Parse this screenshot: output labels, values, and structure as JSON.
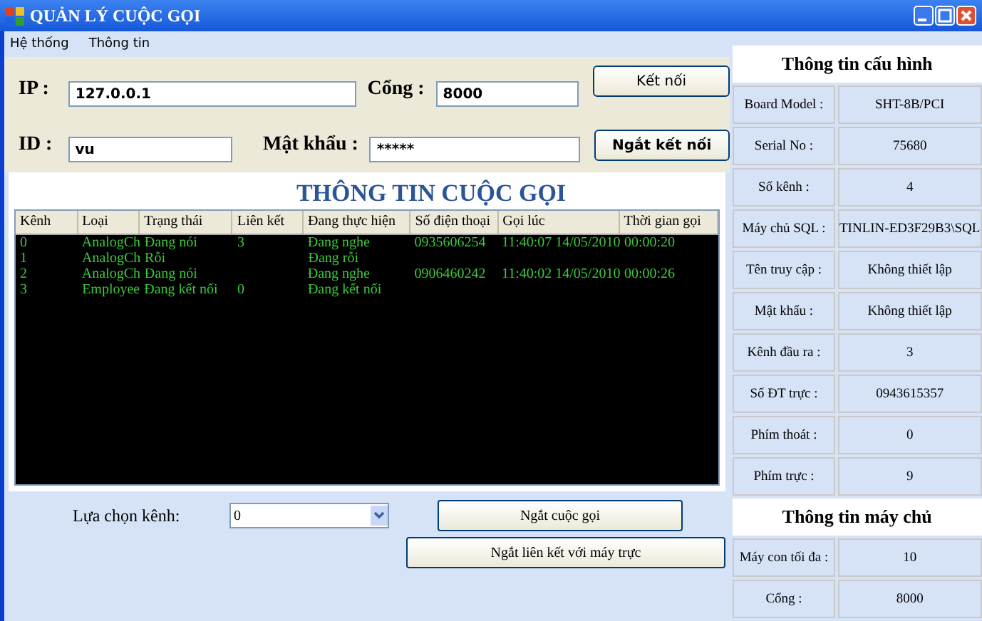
{
  "window": {
    "title": "QUẢN LÝ CUỘC GỌI"
  },
  "menu": [
    "Hệ thống",
    "Thông tin"
  ],
  "connection": {
    "ip_label": "IP :",
    "ip": "127.0.0.1",
    "port_label": "Cổng :",
    "port": "8000",
    "id_label": "ID :",
    "id": "vu",
    "password_label": "Mật khẩu :",
    "password": "*****",
    "connect_button": "Kết nối",
    "disconnect_button": "Ngắt kết nối"
  },
  "calls": {
    "title": "THÔNG TIN CUỘC GỌI",
    "columns": [
      "Kênh",
      "Loại",
      "Trạng thái",
      "Liên kết",
      "Đang thực hiện",
      "Số điện thoại",
      "Gọi lúc",
      "Thời gian gọi"
    ],
    "rows": [
      [
        "0",
        "AnalogCh",
        "Đang nói",
        "3",
        "Đang nghe",
        "0935606254",
        "11:40:07 14/05/2010",
        "00:00:20"
      ],
      [
        "1",
        "AnalogCh",
        "Rỗi",
        "",
        "Đang rỗi",
        "",
        "",
        ""
      ],
      [
        "2",
        "AnalogCh",
        "Đang nói",
        "",
        "Đang nghe",
        "0906460242",
        "11:40:02 14/05/2010",
        "00:00:26"
      ],
      [
        "3",
        "Employee",
        "Đang kết nối",
        "0",
        "Đang kết nối",
        "",
        "",
        ""
      ]
    ]
  },
  "channel_select": {
    "label": "Lựa chọn kênh:",
    "value": "0"
  },
  "hangup_button": "Ngắt cuộc gọi",
  "unlink_button": "Ngắt liên kết với máy trực",
  "config": {
    "title": "Thông tin cấu hình",
    "rows": [
      {
        "label": "Board Model :",
        "value": "SHT-8B/PCI"
      },
      {
        "label": "Serial No :",
        "value": "75680"
      },
      {
        "label": "Số kênh :",
        "value": "4"
      },
      {
        "label": "Máy chủ SQL :",
        "value": "TINLIN-ED3F29B3\\SQL"
      },
      {
        "label": "Tên truy cập :",
        "value": "Không thiết lập"
      },
      {
        "label": "Mật khẩu :",
        "value": "Không thiết lập"
      },
      {
        "label": "Kênh đầu ra :",
        "value": "3"
      },
      {
        "label": "Số ĐT trực :",
        "value": "0943615357"
      },
      {
        "label": "Phím thoát :",
        "value": "0"
      },
      {
        "label": "Phím trực :",
        "value": "9"
      }
    ]
  },
  "server": {
    "title": "Thông tin máy chủ",
    "rows": [
      {
        "label": "Máy con tối đa :",
        "value": "10"
      },
      {
        "label": "Cổng :",
        "value": "8000"
      }
    ]
  }
}
